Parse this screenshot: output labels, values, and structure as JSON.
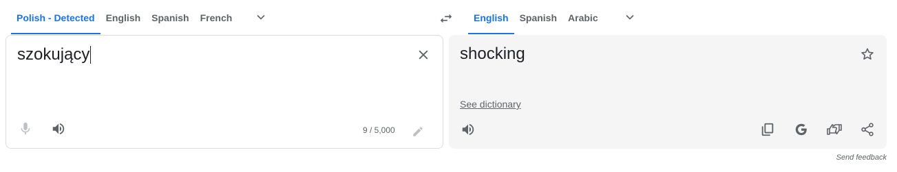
{
  "source": {
    "tabs": [
      {
        "label": "Polish - Detected",
        "active": true
      },
      {
        "label": "English",
        "active": false
      },
      {
        "label": "Spanish",
        "active": false
      },
      {
        "label": "French",
        "active": false
      }
    ],
    "text": "szokujący",
    "char_count": "9 / 5,000",
    "icons": {
      "more_languages": "chevron-down-icon",
      "clear": "close-icon",
      "voice": "microphone-icon",
      "listen": "speaker-icon",
      "edit": "pencil-icon"
    }
  },
  "swap_icon": "swap-arrows-icon",
  "target": {
    "tabs": [
      {
        "label": "English",
        "active": true
      },
      {
        "label": "Spanish",
        "active": false
      },
      {
        "label": "Arabic",
        "active": false
      }
    ],
    "text": "shocking",
    "see_dictionary": "See dictionary",
    "icons": {
      "more_languages": "chevron-down-icon",
      "save": "star-icon",
      "listen": "speaker-icon",
      "copy": "copy-icon",
      "google": "google-g-icon",
      "rate": "thumbs-rate-icon",
      "share": "share-icon"
    }
  },
  "feedback": "Send feedback",
  "colors": {
    "accent": "#1a73e8",
    "text": "#202124",
    "muted": "#5f6368",
    "panel_bg": "#f5f5f5",
    "border": "#dadce0"
  }
}
